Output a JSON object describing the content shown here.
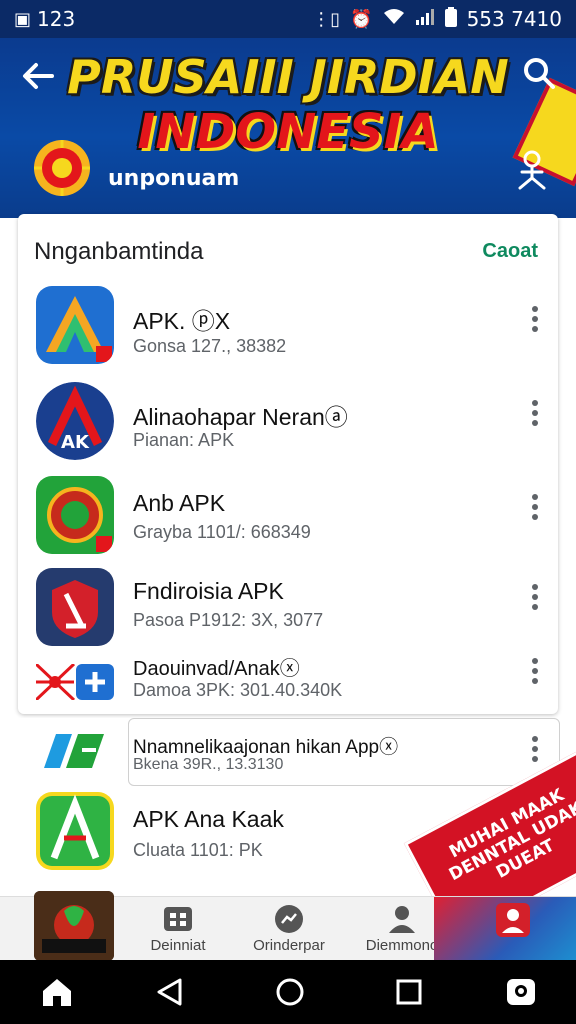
{
  "status_bar": {
    "left_text": "123",
    "right_text": "553 7410",
    "icons": [
      "notification-icon",
      "vibrate-icon",
      "alarm-icon",
      "wifi-icon",
      "signal-icon",
      "battery-icon"
    ]
  },
  "header": {
    "title_line1": "PRUSAIII JIRDIAN",
    "title_line2": "INDONESIA",
    "subtitle": "unponuam",
    "colors": {
      "background": "#0a4aa6",
      "title_yellow": "#f6d81e",
      "title_red": "#e3161b"
    }
  },
  "card": {
    "title": "Nnganbamtinda",
    "action": "Caoat"
  },
  "apps": [
    {
      "name": "APK. ⓟX",
      "subtitle": "Gonsa 127., 38382",
      "icon": "apk-a-logo-icon"
    },
    {
      "name": "Alinaohapar Neranⓐ",
      "subtitle": "Pianan: APK",
      "icon": "ak-shield-icon"
    },
    {
      "name": "Anb APK",
      "subtitle": "Grayba 1101/: 668349",
      "icon": "green-emblem-icon"
    },
    {
      "name": "Fndiroisia APK",
      "subtitle": "Pasoa P1912: 3X, 3077",
      "icon": "red-shield-icon"
    },
    {
      "name": "Daouinvad/Anakⓧ",
      "subtitle": "Damoa 3PK: 301.40.340K",
      "icon": "flag-plus-icon"
    },
    {
      "name": "Nnamnelikaajonan hikan Appⓧ",
      "subtitle": "Bkena 39R., 13.3130",
      "icon": "pf-logo-icon"
    },
    {
      "name": "APK Ana Kaak",
      "subtitle": "Cluata 1101: PK",
      "icon": "green-a-logo-icon"
    }
  ],
  "promo": {
    "text": "MUHAI MAAK DENNTAL UDAK DUEAT"
  },
  "bottom_nav": [
    {
      "label": "Deinniat",
      "icon": "grid-icon"
    },
    {
      "label": "Orinderpar",
      "icon": "chat-bubble-icon"
    },
    {
      "label": "Diemmono",
      "icon": "person-icon"
    }
  ],
  "system_nav": [
    "home-icon",
    "back-icon",
    "recents-circle-icon",
    "overview-square-icon",
    "assistant-icon"
  ]
}
